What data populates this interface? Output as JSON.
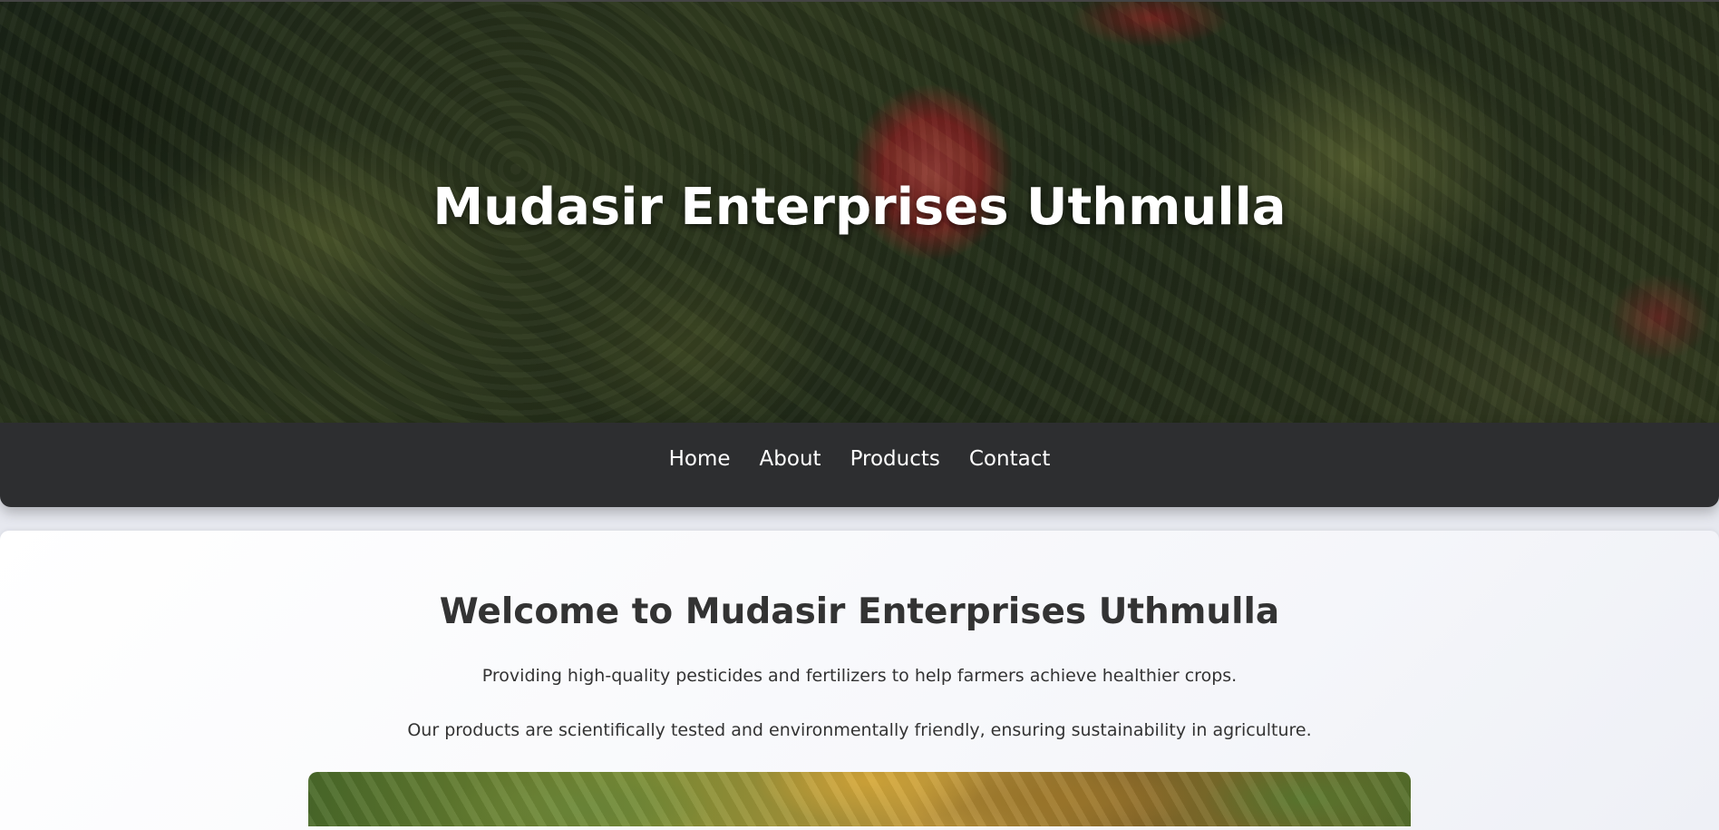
{
  "header": {
    "title": "Mudasir Enterprises Uthmulla"
  },
  "nav": {
    "items": [
      {
        "label": "Home"
      },
      {
        "label": "About"
      },
      {
        "label": "Products"
      },
      {
        "label": "Contact"
      }
    ]
  },
  "main": {
    "heading": "Welcome to Mudasir Enterprises Uthmulla",
    "paragraph_1": "Providing high-quality pesticides and fertilizers to help farmers achieve healthier crops.",
    "paragraph_2": "Our products are scientifically tested and environmentally friendly, ensuring sustainability in agriculture."
  },
  "colors": {
    "navbar_bg": "#2d2e30",
    "nav_text": "#ffffff",
    "heading_text": "#333333",
    "hero_title_text": "#ffffff"
  }
}
